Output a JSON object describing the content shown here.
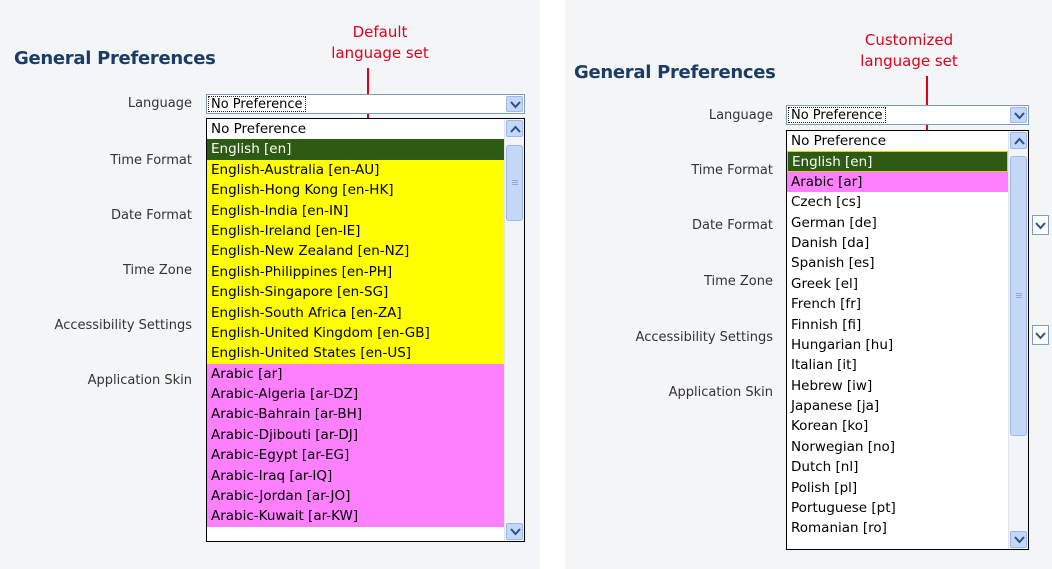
{
  "left": {
    "title": "General Preferences",
    "annotation": [
      "Default",
      "language set"
    ],
    "fields": [
      "Language",
      "Time Format",
      "Date Format",
      "Time Zone",
      "Accessibility Settings",
      "Application Skin"
    ],
    "select_value": "No Preference",
    "options": [
      {
        "label": "No Preference",
        "group": "none"
      },
      {
        "label": "English [en]",
        "group": "selected"
      },
      {
        "label": "English-Australia [en-AU]",
        "group": "default"
      },
      {
        "label": "English-Hong Kong [en-HK]",
        "group": "default"
      },
      {
        "label": "English-India [en-IN]",
        "group": "default"
      },
      {
        "label": "English-Ireland [en-IE]",
        "group": "default"
      },
      {
        "label": "English-New Zealand [en-NZ]",
        "group": "default"
      },
      {
        "label": "English-Philippines [en-PH]",
        "group": "default"
      },
      {
        "label": "English-Singapore [en-SG]",
        "group": "default"
      },
      {
        "label": "English-South Africa [en-ZA]",
        "group": "default"
      },
      {
        "label": "English-United Kingdom [en-GB]",
        "group": "default"
      },
      {
        "label": "English-United States [en-US]",
        "group": "default"
      },
      {
        "label": "Arabic [ar]",
        "group": "arabic"
      },
      {
        "label": "Arabic-Algeria [ar-DZ]",
        "group": "arabic"
      },
      {
        "label": "Arabic-Bahrain [ar-BH]",
        "group": "arabic"
      },
      {
        "label": "Arabic-Djibouti [ar-DJ]",
        "group": "arabic"
      },
      {
        "label": "Arabic-Egypt [ar-EG]",
        "group": "arabic"
      },
      {
        "label": "Arabic-Iraq [ar-IQ]",
        "group": "arabic"
      },
      {
        "label": "Arabic-Jordan [ar-JO]",
        "group": "arabic"
      },
      {
        "label": "Arabic-Kuwait [ar-KW]",
        "group": "arabic"
      }
    ]
  },
  "right": {
    "title": "General Preferences",
    "annotation": [
      "Customized",
      "language set"
    ],
    "fields": [
      "Language",
      "Time Format",
      "Date Format",
      "Time Zone",
      "Accessibility Settings",
      "Application Skin"
    ],
    "select_value": "No Preference",
    "options": [
      {
        "label": "No Preference",
        "group": "none"
      },
      {
        "label": "English [en]",
        "group": "selected"
      },
      {
        "label": "Arabic [ar]",
        "group": "arabic"
      },
      {
        "label": "Czech [cs]",
        "group": "none"
      },
      {
        "label": "German [de]",
        "group": "none"
      },
      {
        "label": "Danish [da]",
        "group": "none"
      },
      {
        "label": "Spanish [es]",
        "group": "none"
      },
      {
        "label": "Greek [el]",
        "group": "none"
      },
      {
        "label": "French [fr]",
        "group": "none"
      },
      {
        "label": "Finnish [fi]",
        "group": "none"
      },
      {
        "label": "Hungarian [hu]",
        "group": "none"
      },
      {
        "label": "Italian [it]",
        "group": "none"
      },
      {
        "label": "Hebrew [iw]",
        "group": "none"
      },
      {
        "label": "Japanese [ja]",
        "group": "none"
      },
      {
        "label": "Korean [ko]",
        "group": "none"
      },
      {
        "label": "Norwegian [no]",
        "group": "none"
      },
      {
        "label": "Dutch [nl]",
        "group": "none"
      },
      {
        "label": "Polish [pl]",
        "group": "none"
      },
      {
        "label": "Portuguese [pt]",
        "group": "none"
      },
      {
        "label": "Romanian [ro]",
        "group": "none"
      }
    ]
  },
  "colors": {
    "default_set": "#ffff00",
    "arabic_set": "#ff80ff",
    "selected": "#2e5b14",
    "annotation": "#e0001a",
    "title": "#1b3c64"
  }
}
